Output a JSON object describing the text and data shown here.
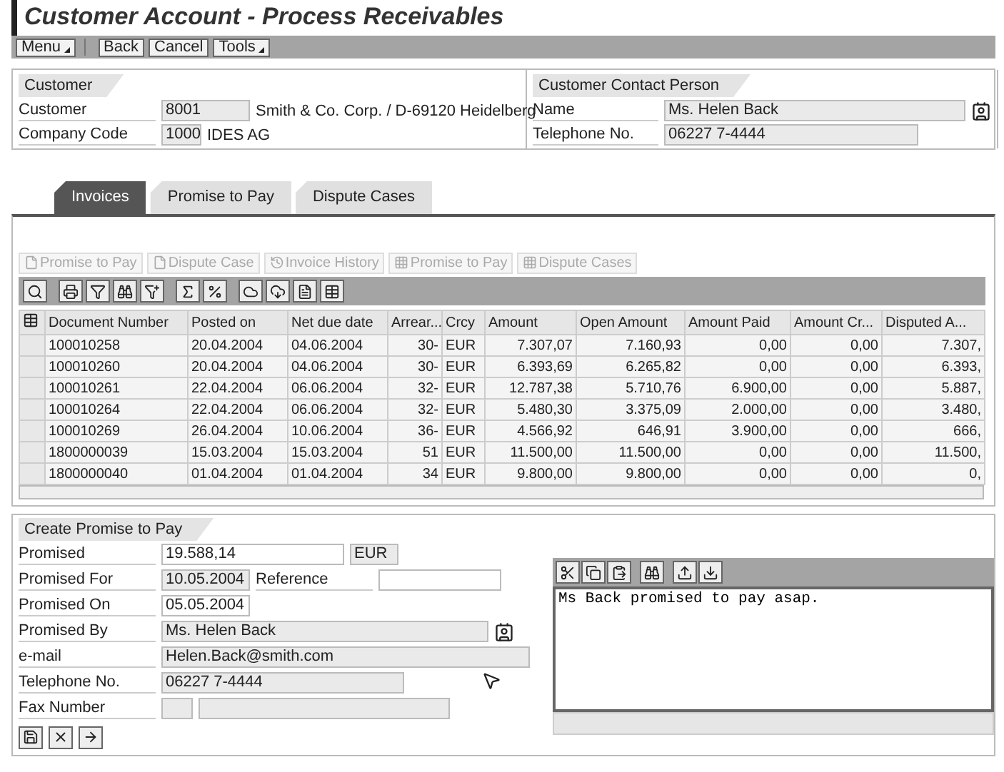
{
  "title": "Customer Account - Process Receivables",
  "toolbar": [
    {
      "label": "Menu",
      "kind": "menu"
    },
    {
      "label": "Back",
      "kind": "button"
    },
    {
      "label": "Cancel",
      "kind": "button"
    },
    {
      "label": "Tools",
      "kind": "menu"
    }
  ],
  "customer": {
    "title": "Customer",
    "fields": [
      {
        "label": "Customer",
        "value": "8001",
        "description": "Smith & Co. Corp. / D-69120 Heidelberg"
      },
      {
        "label": "Company Code",
        "value": "1000",
        "description": "IDES AG"
      }
    ]
  },
  "contact": {
    "title": "Customer Contact Person",
    "fields": [
      {
        "label": "Name",
        "value": "Ms. Helen Back",
        "lookup": true
      },
      {
        "label": "Telephone No.",
        "value": "06227 7-4444",
        "lookup": false
      }
    ]
  },
  "tabs": [
    {
      "label": "Invoices",
      "selected": true
    },
    {
      "label": "Promise to Pay",
      "selected": false
    },
    {
      "label": "Dispute Cases",
      "selected": false
    }
  ],
  "actions": [
    {
      "label": "Promise to Pay",
      "kind": "doc",
      "disabled": true
    },
    {
      "label": "Dispute Case",
      "kind": "doc",
      "disabled": true
    },
    {
      "label": "Invoice History",
      "kind": "history",
      "disabled": true
    },
    {
      "label": "Promise to Pay",
      "kind": "grid",
      "disabled": true
    },
    {
      "label": "Dispute Cases",
      "kind": "grid",
      "disabled": true
    }
  ],
  "table": {
    "columns": [
      "Document Number",
      "Posted on",
      "Net due date",
      "Arrear...",
      "Crcy",
      "Amount",
      "Open Amount",
      "Amount Paid",
      "Amount Cr...",
      "Disputed A..."
    ],
    "rows": [
      [
        "100010258",
        "20.04.2004",
        "04.06.2004",
        "30-",
        "EUR",
        "7.307,07",
        "7.160,93",
        "0,00",
        "0,00",
        "7.307,"
      ],
      [
        "100010260",
        "20.04.2004",
        "04.06.2004",
        "30-",
        "EUR",
        "6.393,69",
        "6.265,82",
        "0,00",
        "0,00",
        "6.393,"
      ],
      [
        "100010261",
        "22.04.2004",
        "06.06.2004",
        "32-",
        "EUR",
        "12.787,38",
        "5.710,76",
        "6.900,00",
        "0,00",
        "5.887,"
      ],
      [
        "100010264",
        "22.04.2004",
        "06.06.2004",
        "32-",
        "EUR",
        "5.480,30",
        "3.375,09",
        "2.000,00",
        "0,00",
        "3.480,"
      ],
      [
        "100010269",
        "26.04.2004",
        "10.06.2004",
        "36-",
        "EUR",
        "4.566,92",
        "646,91",
        "3.900,00",
        "0,00",
        "666,"
      ],
      [
        "1800000039",
        "15.03.2004",
        "15.03.2004",
        "51",
        "EUR",
        "11.500,00",
        "11.500,00",
        "0,00",
        "0,00",
        "11.500,"
      ],
      [
        "1800000040",
        "01.04.2004",
        "01.04.2004",
        "34",
        "EUR",
        "9.800,00",
        "9.800,00",
        "0,00",
        "0,00",
        "0,"
      ]
    ]
  },
  "promise": {
    "title": "Create Promise to Pay",
    "fields": [
      {
        "kind": "amount",
        "label": "Promised",
        "value": "19.588,14",
        "unit": "EUR",
        "editable": true
      },
      {
        "kind": "reference",
        "label": "Promised For",
        "value": "10.05.2004",
        "label_2": "Reference",
        "editable": false
      },
      {
        "kind": "date",
        "label": "Promised On",
        "value": "05.05.2004",
        "editable": true
      },
      {
        "kind": "person",
        "label": "Promised By",
        "value": "Ms. Helen Back",
        "editable": false
      },
      {
        "kind": "text",
        "label": "e-mail",
        "value": "Helen.Back@smith.com",
        "editable": false
      },
      {
        "kind": "phone",
        "label": "Telephone No.",
        "value": "06227 7-4444",
        "editable": false
      },
      {
        "kind": "fax",
        "label": "Fax Number",
        "editable": false
      }
    ]
  },
  "note": {
    "text": "Ms Back promised to pay asap."
  }
}
